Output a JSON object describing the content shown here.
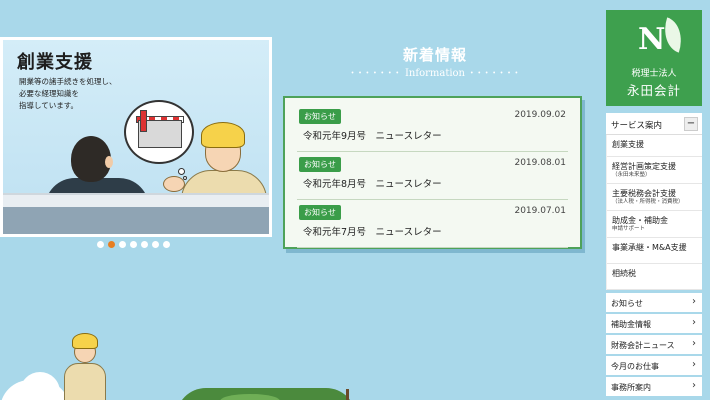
{
  "slider": {
    "title": "創業支援",
    "desc": [
      "開業等の諸手続きを処理し、",
      "必要な経理知識を",
      "指導しています。"
    ],
    "dots": 7,
    "active_index": 1
  },
  "news": {
    "heading": "新着情報",
    "subheading": "Information",
    "items": [
      {
        "badge": "お知らせ",
        "date": "2019.09.02",
        "title": "令和元年9月号　ニュースレター"
      },
      {
        "badge": "お知らせ",
        "date": "2019.08.01",
        "title": "令和元年8月号　ニュースレター"
      },
      {
        "badge": "お知らせ",
        "date": "2019.07.01",
        "title": "令和元年7月号　ニュースレター"
      }
    ]
  },
  "logo": {
    "mark": "N",
    "sub": "税理士法人",
    "name": "永田会計"
  },
  "menu": {
    "head": "サービス案内",
    "toggle": "−",
    "items": [
      {
        "label": "創業支援",
        "small": ""
      },
      {
        "label": "経営計画策定支援",
        "small": "（永田未来塾）"
      },
      {
        "label": "主要税務会計支援",
        "small": "（法人税・所得税・消費税）"
      },
      {
        "label": "助成金・補助金",
        "small": "申請サポート"
      },
      {
        "label": "事業承継・M&A支援",
        "small": ""
      },
      {
        "label": "相続税",
        "small": ""
      }
    ]
  },
  "navs": [
    {
      "label": "お知らせ",
      "arrow": "›"
    },
    {
      "label": "補助金情報",
      "arrow": "›"
    },
    {
      "label": "財務会計ニュース",
      "arrow": "›"
    },
    {
      "label": "今月のお仕事",
      "arrow": "›"
    },
    {
      "label": "事務所案内",
      "arrow": "›"
    }
  ],
  "colors": {
    "background": "#a9d8ea",
    "brand_green": "#3ea04e",
    "active_dot": "#e67e22"
  }
}
